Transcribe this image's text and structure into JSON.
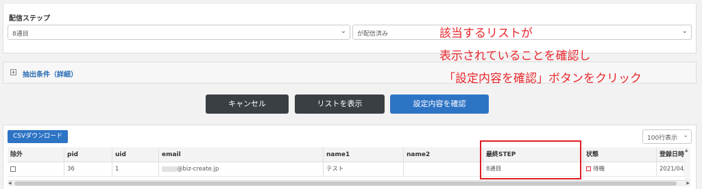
{
  "step_section": {
    "label": "配信ステップ",
    "step_select_value": "8通目",
    "status_select_value": "が配信済み"
  },
  "filter": {
    "toggle_icon": "plus-square-icon",
    "label": "抽出条件（詳細）"
  },
  "buttons": {
    "cancel": "キャンセル",
    "show_list": "リストを表示",
    "confirm": "設定内容を確認"
  },
  "annotation": {
    "line1": "該当するリストが",
    "line2": "表示されていることを確認し",
    "line3": "「設定内容を確認」ボタンをクリック"
  },
  "table": {
    "csv_button": "CSVダウンロード",
    "rows_per_page": "100行表示",
    "columns": [
      "除外",
      "pid",
      "uid",
      "email",
      "name1",
      "name2",
      "最終STEP",
      "状態",
      "登録日時"
    ],
    "rows": [
      {
        "exclude": "",
        "pid": "36",
        "uid": "1",
        "email": "@biz-create.jp",
        "name1": "テスト",
        "name2": "",
        "last_step": "8通目",
        "status": "待機",
        "registered": "2021/04/"
      }
    ]
  },
  "colors": {
    "accent_blue": "#2e74c5",
    "dark_button": "#3a3f44",
    "annotation_red": "#e8272d"
  }
}
